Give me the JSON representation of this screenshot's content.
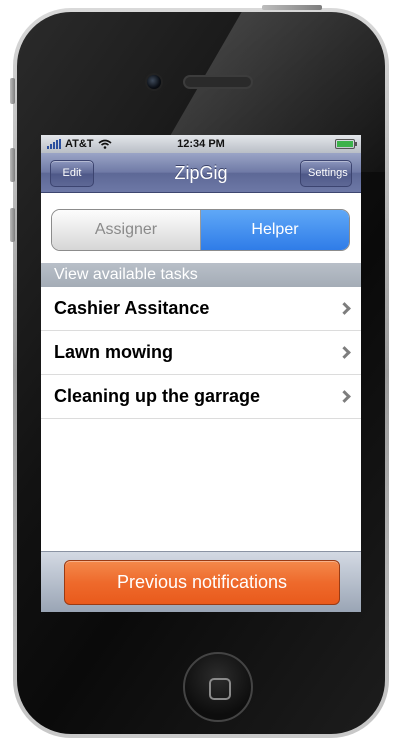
{
  "status_bar": {
    "carrier": "AT&T",
    "time": "12:34 PM",
    "icons": [
      "signal-bars-icon",
      "wifi-icon",
      "battery-icon"
    ],
    "battery_level": 1.0
  },
  "nav_bar": {
    "title": "ZipGig",
    "left_button": "Edit",
    "right_button": "Settings"
  },
  "segmented_control": {
    "segments": [
      "Assigner",
      "Helper"
    ],
    "selected": "Helper"
  },
  "section": {
    "header": "View available tasks",
    "items": [
      {
        "label": "Cashier Assitance",
        "icon": "chevron-right-icon"
      },
      {
        "label": "Lawn mowing",
        "icon": "chevron-right-icon"
      },
      {
        "label": "Cleaning up the garrage",
        "icon": "chevron-right-icon"
      }
    ]
  },
  "bottom_bar": {
    "button_label": "Previous notifications"
  },
  "colors": {
    "nav_bar": "#6f7aa6",
    "segment_selected": "#2f7ce8",
    "notification_button": "#ee6a2c"
  }
}
